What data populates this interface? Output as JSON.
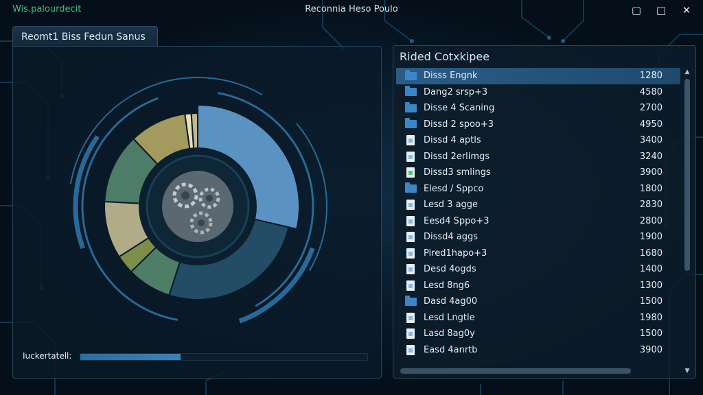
{
  "window": {
    "app_name": "Wis.palourdecit",
    "title": "Reconnia Heso Poulo",
    "buttons": {
      "minimize": "▢",
      "maximize": "□",
      "close": "✕"
    }
  },
  "left_panel": {
    "tab_label": "Reomt1 Biss Fedun Sanus",
    "progress_label": "Iuckertatell:",
    "progress_value": 0.35
  },
  "chart_data": {
    "type": "pie",
    "style": "donut",
    "slices": [
      {
        "value": 26,
        "color": "#5a93c2"
      },
      {
        "value": 24,
        "color": "#234c66"
      },
      {
        "value": 7,
        "color": "#4e7e68"
      },
      {
        "value": 3,
        "color": "#7d8d4a"
      },
      {
        "value": 9,
        "color": "#b2ab87"
      },
      {
        "value": 11,
        "color": "#4d7c69"
      },
      {
        "value": 9,
        "color": "#a59a5e"
      },
      {
        "value": 1,
        "color": "#e6dfb8"
      },
      {
        "value": 1,
        "color": "#c4b789"
      }
    ]
  },
  "right_panel": {
    "header": "Rided Cotxkipee",
    "items": [
      {
        "icon": "folder-icon",
        "name": "Disss Engnk",
        "value": "1280",
        "selected": true
      },
      {
        "icon": "folder-icon",
        "name": "Dang2 srsp+3",
        "value": "4580"
      },
      {
        "icon": "folder-icon",
        "name": "Disse 4 Scaning",
        "value": "2700"
      },
      {
        "icon": "folder-icon",
        "name": "Dissd 2 spoo+3",
        "value": "4950"
      },
      {
        "icon": "file-icon",
        "name": "Dissd 4 aptls",
        "value": "3400"
      },
      {
        "icon": "file-icon",
        "name": "Dissd 2erlimgs",
        "value": "3240"
      },
      {
        "icon": "file-green-icon",
        "name": "Dissd3 smlings",
        "value": "3900"
      },
      {
        "icon": "folder-icon",
        "name": "Elesd / Sppco",
        "value": "1800"
      },
      {
        "icon": "file-icon",
        "name": "Lesd 3 agge",
        "value": "2830"
      },
      {
        "icon": "file-icon",
        "name": "Eesd4 Sppo+3",
        "value": "2800"
      },
      {
        "icon": "file-icon",
        "name": "Dissd4 aggs",
        "value": "1900"
      },
      {
        "icon": "file-icon",
        "name": "Pired1hapo+3",
        "value": "1680"
      },
      {
        "icon": "file-icon",
        "name": "Desd 4ogds",
        "value": "1400"
      },
      {
        "icon": "file-icon",
        "name": "Lesd 8ng6",
        "value": "1300"
      },
      {
        "icon": "folder-icon",
        "name": "Dasd 4ag00",
        "value": "1500"
      },
      {
        "icon": "file-icon",
        "name": "Lesd Lngtle",
        "value": "1980"
      },
      {
        "icon": "file-icon",
        "name": "Lasd 8ag0y",
        "value": "1500"
      },
      {
        "icon": "file-icon",
        "name": "Easd 4anrtb",
        "value": "3900"
      }
    ]
  },
  "colors": {
    "accent": "#3b86c8",
    "selection": "#2b5c86",
    "app_name": "#3fbf7f"
  }
}
